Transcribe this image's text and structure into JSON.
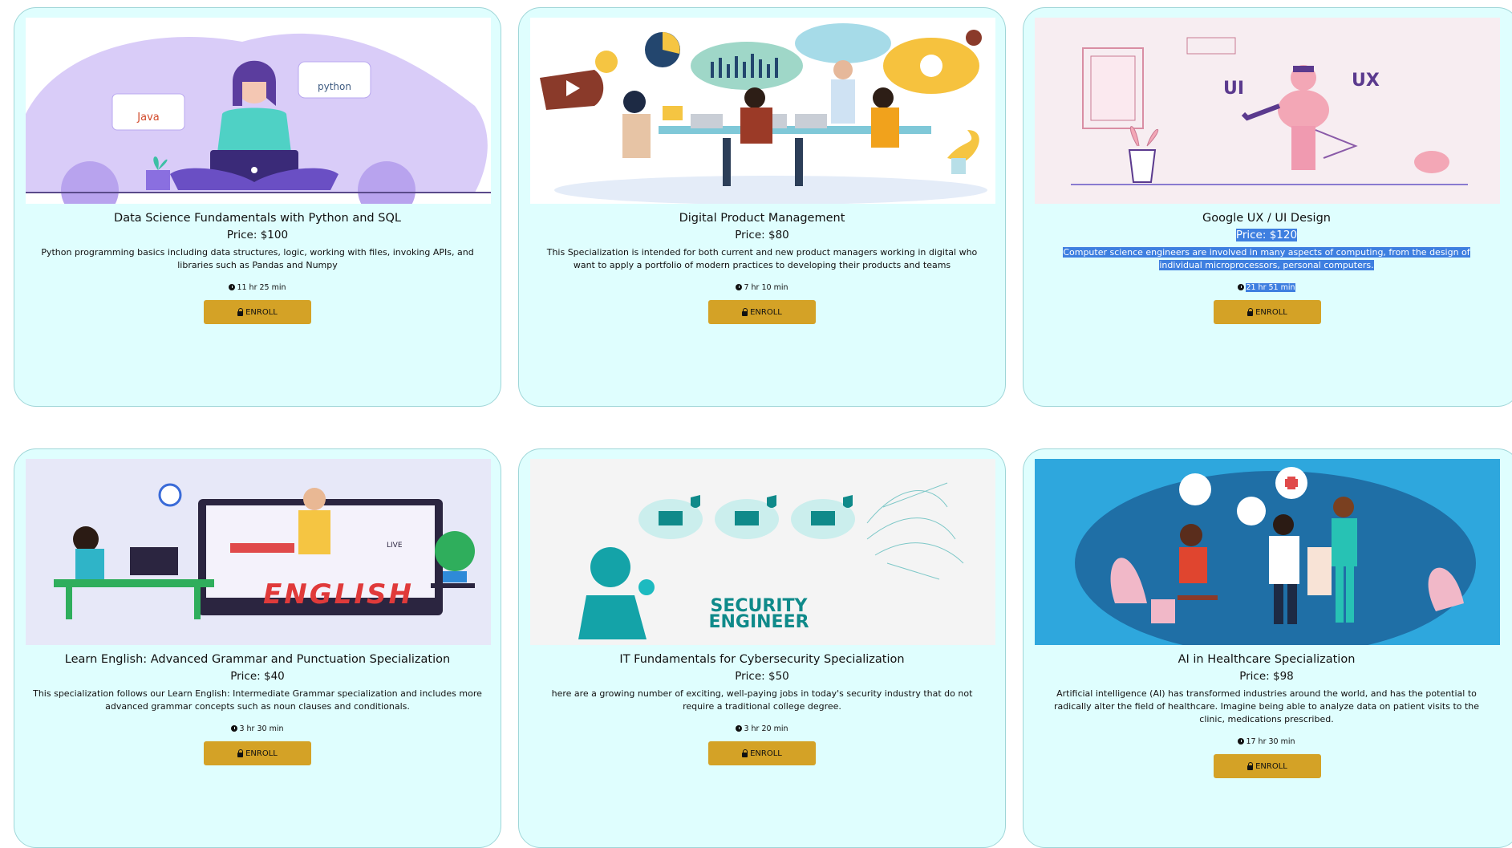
{
  "courses": [
    {
      "title": "Data Science Fundamentals with Python and SQL",
      "price": "Price: $100",
      "description": "Python programming basics including data structures, logic, working with files, invoking APIs, and libraries such as Pandas and Numpy",
      "duration": "11 hr 25 min",
      "button": "ENROLL",
      "image_icon": "python-java-developer-illustration",
      "image_text": [
        "Java",
        "python"
      ]
    },
    {
      "title": "Digital Product Management",
      "price": "Price: $80",
      "description": "This Specialization is intended for both current and new product managers working in digital who want to apply a portfolio of modern practices to developing their products and teams",
      "duration": "7 hr 10 min",
      "button": "ENROLL",
      "image_icon": "team-meeting-illustration"
    },
    {
      "title": "Google UX / UI Design",
      "price": "Price: $120",
      "description": "Computer science engineers are involved in many aspects of computing, from the design of individual microprocessors, personal computers.",
      "duration": "21 hr 51 min",
      "button": "ENROLL",
      "image_icon": "ux-ui-designer-illustration",
      "image_text": [
        "UI",
        "UX"
      ]
    },
    {
      "title": "Learn English: Advanced Grammar and Punctuation Specialization",
      "price": "Price: $40",
      "description": "This specialization follows our Learn English: Intermediate Grammar specialization and includes more advanced grammar concepts such as noun clauses and conditionals.",
      "duration": "3 hr 30 min",
      "button": "ENROLL",
      "image_icon": "english-online-class-illustration",
      "image_text": [
        "ENGLISH",
        "LIVE"
      ]
    },
    {
      "title": "IT Fundamentals for Cybersecurity Specialization",
      "price": "Price: $50",
      "description": "here are a growing number of exciting, well-paying jobs in today's security industry that do not require a traditional college degree.",
      "duration": "3 hr 20 min",
      "button": "ENROLL",
      "image_icon": "security-engineer-illustration",
      "image_text": [
        "SECURITY",
        "ENGINEER"
      ]
    },
    {
      "title": "AI in Healthcare Specialization",
      "price": "Price: $98",
      "description": "Artificial intelligence (AI) has transformed industries around the world, and has the potential to radically alter the field of healthcare. Imagine being able to analyze data on patient visits to the clinic, medications prescribed.",
      "duration": "17 hr 30 min",
      "button": "ENROLL",
      "image_icon": "healthcare-doctors-illustration"
    }
  ],
  "colors": {
    "card_bg": "#dffefe",
    "card_border": "#9fd6d8",
    "button_bg": "#d4a226",
    "selection": "#3e7fe0"
  }
}
